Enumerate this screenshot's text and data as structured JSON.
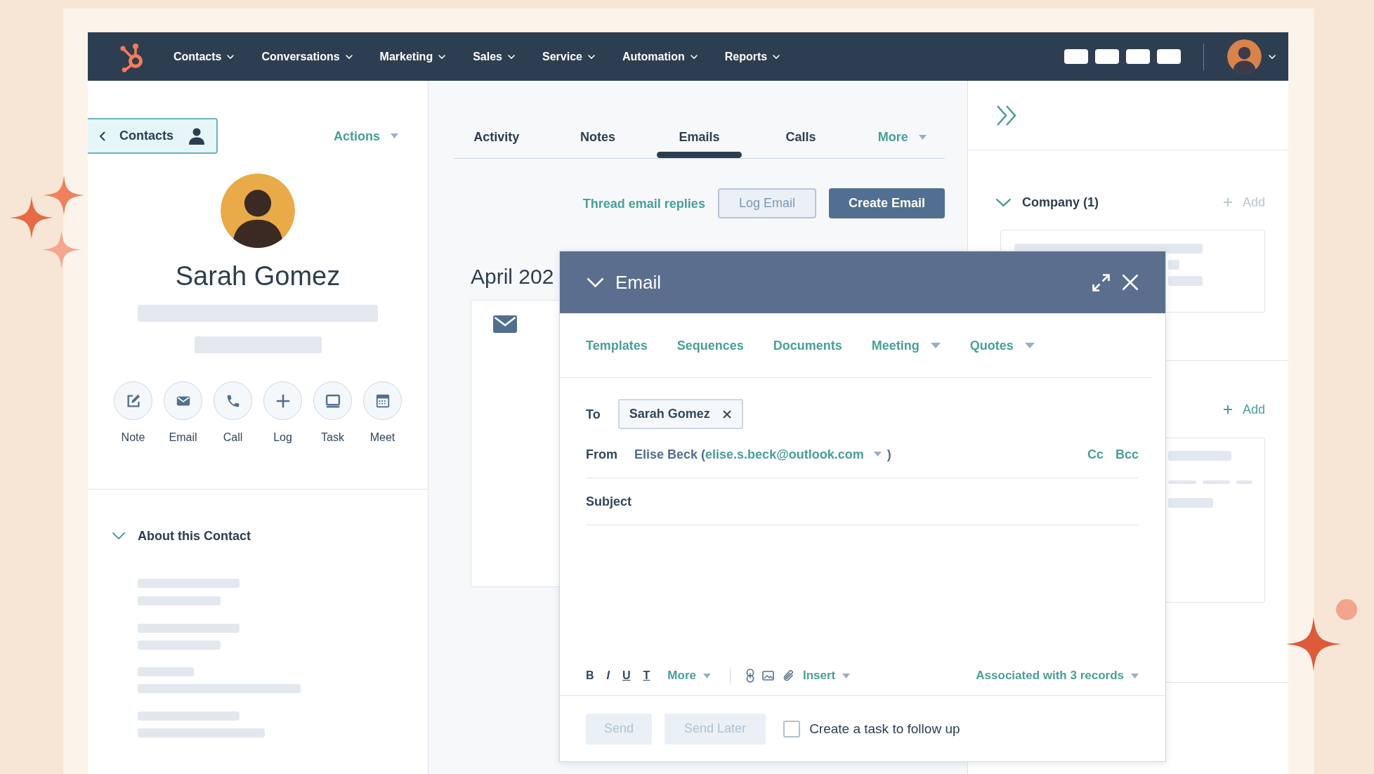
{
  "nav": {
    "menu": [
      {
        "label": "Contacts"
      },
      {
        "label": "Conversations"
      },
      {
        "label": "Marketing"
      },
      {
        "label": "Sales"
      },
      {
        "label": "Service"
      },
      {
        "label": "Automation"
      },
      {
        "label": "Reports"
      }
    ]
  },
  "contact": {
    "back_button": "Contacts",
    "actions": "Actions",
    "name": "Sarah Gomez",
    "quick_actions": [
      {
        "label": "Note",
        "kind": "note"
      },
      {
        "label": "Email",
        "kind": "email"
      },
      {
        "label": "Call",
        "kind": "call"
      },
      {
        "label": "Log",
        "kind": "log"
      },
      {
        "label": "Task",
        "kind": "task"
      },
      {
        "label": "Meet",
        "kind": "meet"
      }
    ],
    "about": {
      "title": "About this Contact",
      "expanded": true
    }
  },
  "timeline": {
    "tabs": [
      {
        "label": "Activity",
        "kind": "tab",
        "selected": false
      },
      {
        "label": "Notes",
        "kind": "tab",
        "selected": false
      },
      {
        "label": "Emails",
        "kind": "tab",
        "selected": true
      },
      {
        "label": "Calls",
        "kind": "tab",
        "selected": false
      },
      {
        "label": "More",
        "kind": "dropdown",
        "selected": false
      }
    ],
    "thread_link": "Thread email replies",
    "buttons": [
      {
        "label": "Log Email",
        "kind": "secondary"
      },
      {
        "label": "Create Email",
        "kind": "primary"
      }
    ],
    "month": "April 202"
  },
  "email_composer": {
    "title": "Email",
    "expanded": true,
    "tools": [
      {
        "label": "Templates",
        "dropdown": false
      },
      {
        "label": "Sequences",
        "dropdown": false
      },
      {
        "label": "Documents",
        "dropdown": false
      },
      {
        "label": "Meeting",
        "dropdown": true
      },
      {
        "label": "Quotes",
        "dropdown": true
      }
    ],
    "to": {
      "label": "To",
      "recipients": [
        "Sarah Gomez"
      ]
    },
    "from": {
      "label": "From",
      "sender": "Elise Beck (",
      "email": "elise.s.beck@outlook.com",
      "close": ")",
      "cc": "Cc",
      "bcc": "Bcc"
    },
    "subject": {
      "label": "Subject"
    },
    "format_buttons": [
      {
        "label": "B",
        "kind": "bold"
      },
      {
        "label": "I",
        "kind": "italic"
      },
      {
        "label": "U",
        "kind": "underline"
      },
      {
        "label": "T",
        "kind": "clear"
      }
    ],
    "more": "More",
    "insert": "Insert",
    "associations": "Associated with 3 records",
    "send": {
      "label": "Send",
      "disabled": true
    },
    "send_later": {
      "label": "Send Later",
      "disabled": true
    },
    "follow_up": {
      "label": "Create a task to follow up",
      "checked": false
    }
  },
  "sidebar": {
    "sections": [
      {
        "title": "Company (1)",
        "expanded": true,
        "add": "Add",
        "add_disabled": true
      },
      {
        "add": "Add",
        "add_disabled": false
      }
    ]
  }
}
